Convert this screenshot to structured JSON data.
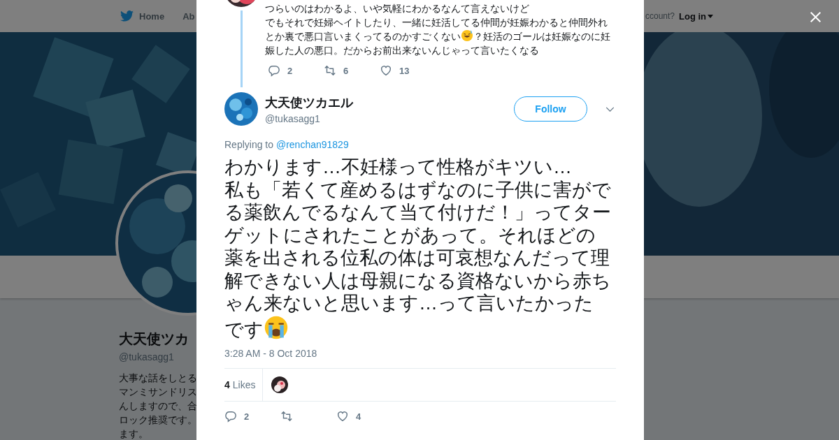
{
  "background_page": {
    "nav": {
      "items": [
        "Home",
        "Ab"
      ],
      "login_prompt": "ccount?",
      "login": "Log in"
    },
    "profile": {
      "name": "大天使ツカ",
      "handle": "@tukasagg1",
      "bio_lines": [
        "大事な話をしとる",
        "マンミサンドリス",
        "んしますので、合",
        "ロック推奨です。",
        "ます。"
      ]
    }
  },
  "previous_tweet": {
    "segments": [
      {
        "kind": "text",
        "text": "つらいのはわかるよ、いや気軽にわかるなんて言えないけど"
      },
      {
        "kind": "line_break"
      },
      {
        "kind": "text",
        "text": "でもそれで妊婦ヘイトしたり、一緒に妊活してる仲間が妊娠わかると仲間外れとか裏で悪口言いまくってるのかすごくない"
      },
      {
        "kind": "sweat_smile"
      },
      {
        "kind": "text",
        "text": "？妊活のゴールは妊娠なのに妊娠した人の悪口。だからお前出来ないんじゃって言いたくなる"
      }
    ],
    "replies": "2",
    "retweets": "6",
    "likes": "13"
  },
  "tweet": {
    "author": {
      "name": "大天使ツカエル",
      "handle": "@tukasagg1"
    },
    "follow_label": "Follow",
    "replying_label": "Replying to",
    "replying_to": "@renchan91829",
    "segments": [
      {
        "kind": "text",
        "text": "わかります…不妊様って性格がキツい…"
      },
      {
        "kind": "line_break"
      },
      {
        "kind": "text",
        "text": "私も「若くて産めるはずなのに子供に害がでる薬飲んでるなんて当て付けだ！」ってターゲットにされたことがあって。それほどの薬を出される位私の体は可哀想なんだって理解できない人は母親になる資格ないから赤ちゃん来ないと思います…って言いたかったです"
      },
      {
        "kind": "crying"
      }
    ],
    "timestamp": "3:28 AM - 8 Oct 2018",
    "likes_count": "4",
    "likes_label": "Likes",
    "replies": "2",
    "likes": "4"
  }
}
